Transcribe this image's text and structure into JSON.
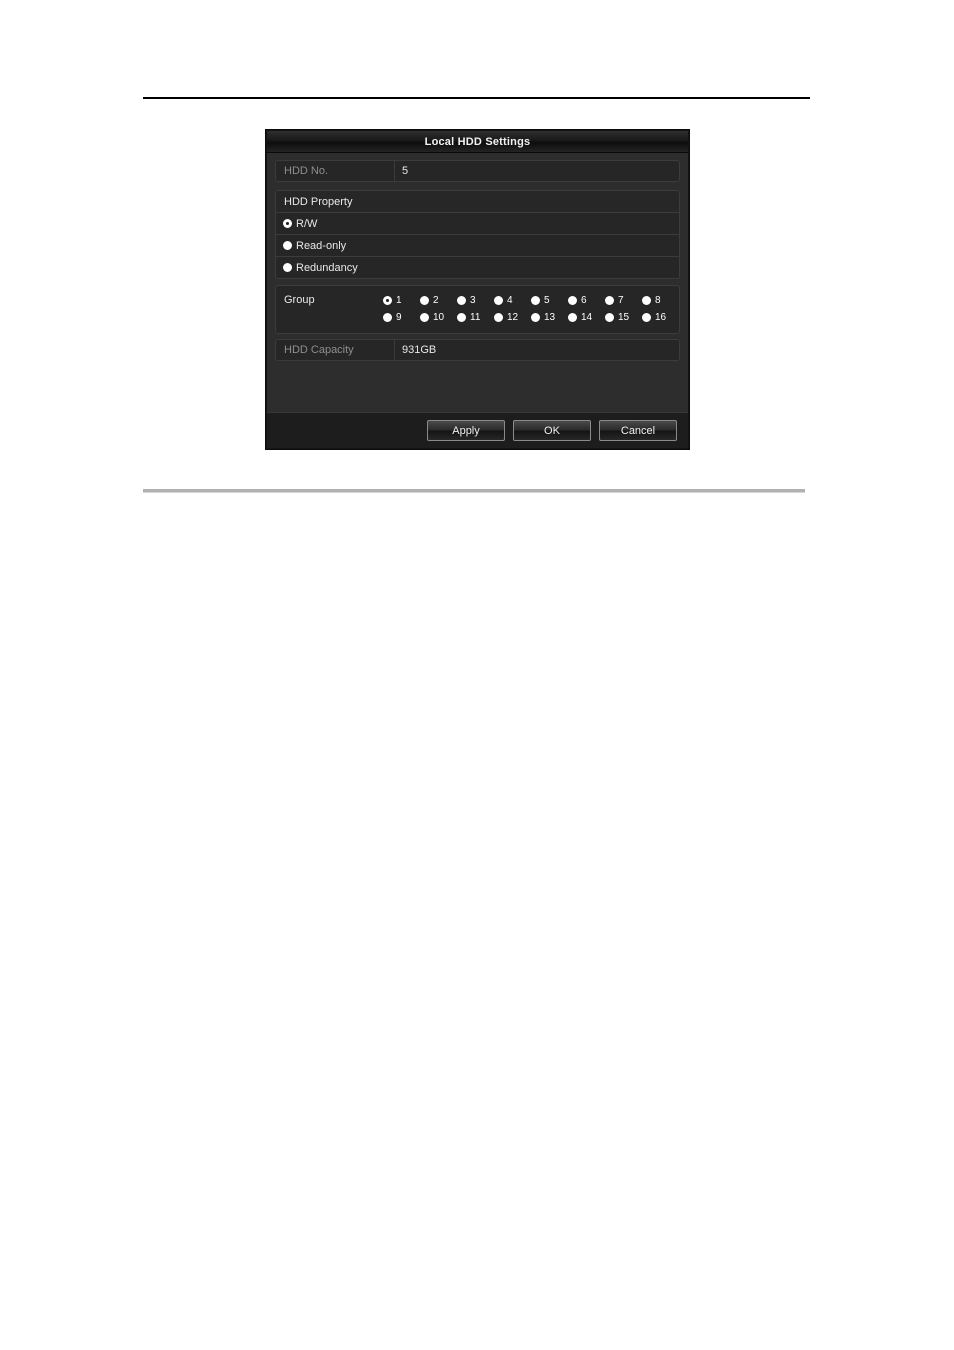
{
  "dialog": {
    "title": "Local HDD Settings",
    "hdd_no": {
      "label": "HDD No.",
      "value": "5"
    },
    "hdd_property": {
      "header": "HDD Property",
      "options": [
        {
          "label": "R/W",
          "selected": true
        },
        {
          "label": "Read-only",
          "selected": false
        },
        {
          "label": "Redundancy",
          "selected": false
        }
      ]
    },
    "group": {
      "label": "Group",
      "selected": "1",
      "row1": [
        "1",
        "2",
        "3",
        "4",
        "5",
        "6",
        "7",
        "8"
      ],
      "row2": [
        "9",
        "10",
        "11",
        "12",
        "13",
        "14",
        "15",
        "16"
      ]
    },
    "hdd_capacity": {
      "label": "HDD Capacity",
      "value": "931GB"
    },
    "buttons": {
      "apply": "Apply",
      "ok": "OK",
      "cancel": "Cancel"
    }
  }
}
